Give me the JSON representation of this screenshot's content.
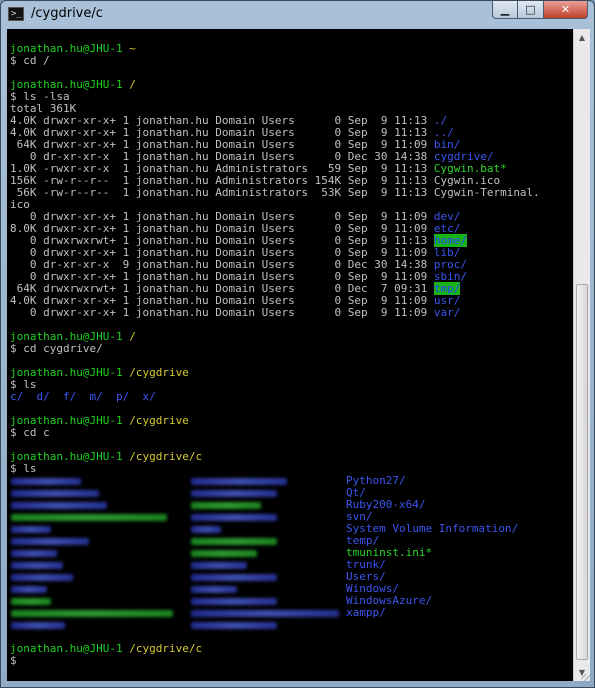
{
  "window": {
    "title": "/cygdrive/c",
    "app_icon": "cygwin-terminal-icon",
    "controls": {
      "minimize": "minimize-icon",
      "maximize": "maximize-icon",
      "close": "close-icon"
    }
  },
  "colors": {
    "user": "#1fd21f",
    "path": "#d6cb2f",
    "dir": "#3d56f0",
    "exec": "#2ad52a",
    "text": "#c0c0c0",
    "bg": "#000000"
  },
  "prompt": {
    "user": "jonathan.hu@JHU-1",
    "symbol": "$"
  },
  "blocks": {
    "b1": {
      "path": "~",
      "cmd": "cd /"
    },
    "b2": {
      "path": "/",
      "cmd": "ls -lsa",
      "total": "total 361K",
      "rows": [
        {
          "meta": "4.0K drwxr-xr-x+ 1 jonathan.hu Domain Users      0 Sep  9 11:13 ",
          "name": "./"
        },
        {
          "meta": "4.0K drwxr-xr-x+ 1 jonathan.hu Domain Users      0 Sep  9 11:13 ",
          "name": "../"
        },
        {
          "meta": " 64K drwxr-xr-x+ 1 jonathan.hu Domain Users      0 Sep  9 11:09 ",
          "name": "bin/"
        },
        {
          "meta": "   0 dr-xr-xr-x  1 jonathan.hu Domain Users      0 Dec 30 14:38 ",
          "name": "cygdrive/"
        },
        {
          "meta": "1.0K -rwxr-xr-x  1 jonathan.hu Administrators   59 Sep  9 11:13 ",
          "name": "Cygwin.bat*"
        },
        {
          "meta": "156K -rw-r--r--  1 jonathan.hu Administrators 154K Sep  9 11:13 ",
          "name": "Cygwin.ico"
        },
        {
          "meta": " 56K -rw-r--r--  1 jonathan.hu Administrators  53K Sep  9 11:13 ",
          "name": "Cygwin-Terminal."
        },
        {
          "meta": "",
          "name": "ico"
        },
        {
          "meta": "   0 drwxr-xr-x+ 1 jonathan.hu Domain Users      0 Sep  9 11:09 ",
          "name": "dev/"
        },
        {
          "meta": "8.0K drwxr-xr-x+ 1 jonathan.hu Domain Users      0 Sep  9 11:09 ",
          "name": "etc/"
        },
        {
          "meta": "   0 drwxrwxrwt+ 1 jonathan.hu Domain Users      0 Sep  9 11:13 ",
          "name": "home/"
        },
        {
          "meta": "   0 drwxr-xr-x+ 1 jonathan.hu Domain Users      0 Sep  9 11:09 ",
          "name": "lib/"
        },
        {
          "meta": "   0 dr-xr-xr-x  9 jonathan.hu Domain Users      0 Dec 30 14:38 ",
          "name": "proc/"
        },
        {
          "meta": "   0 drwxr-xr-x+ 1 jonathan.hu Domain Users      0 Sep  9 11:09 ",
          "name": "sbin/"
        },
        {
          "meta": " 64K drwxrwxrwt+ 1 jonathan.hu Domain Users      0 Dec  7 09:31 ",
          "name": "tmp/"
        },
        {
          "meta": "4.0K drwxr-xr-x+ 1 jonathan.hu Domain Users      0 Sep  9 11:09 ",
          "name": "usr/"
        },
        {
          "meta": "   0 drwxr-xr-x+ 1 jonathan.hu Domain Users      0 Sep  9 11:09 ",
          "name": "var/"
        }
      ]
    },
    "b3": {
      "path": "/",
      "cmd": "cd cygdrive/"
    },
    "b4": {
      "path": "/cygdrive",
      "cmd": "ls",
      "items": [
        "c/",
        "d/",
        "f/",
        "m/",
        "p/",
        "x/"
      ]
    },
    "b5": {
      "path": "/cygdrive",
      "cmd": "cd c"
    },
    "b6": {
      "path": "/cygdrive/c",
      "cmd": "ls",
      "visible_items": [
        "Python27/",
        "Qt/",
        "Ruby200-x64/",
        "svn/",
        "System Volume Information/",
        "temp/",
        "tmuninst.ini*",
        "trunk/",
        "Users/",
        "Windows/",
        "WindowsAzure/",
        "xampp/"
      ]
    },
    "b7": {
      "path": "/cygdrive/c"
    }
  }
}
